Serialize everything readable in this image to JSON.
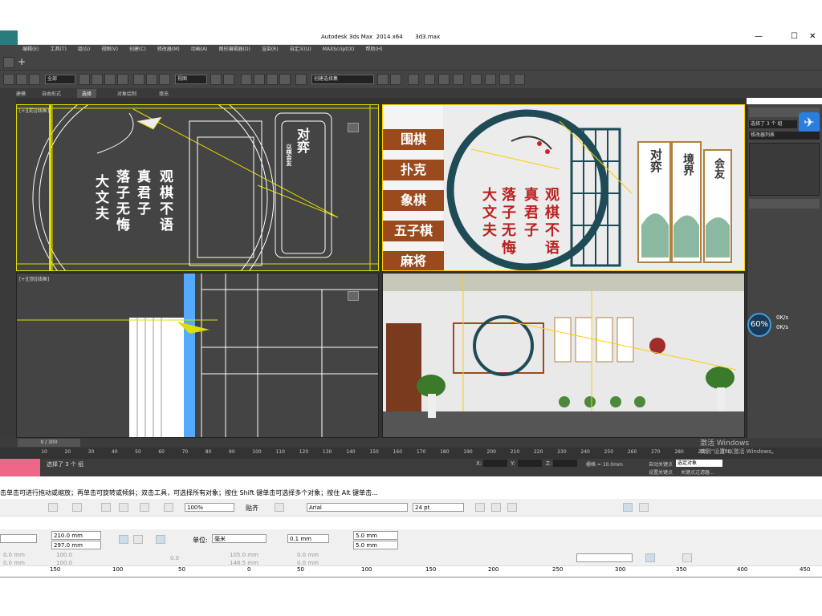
{
  "titlebar": {
    "title": "Autodesk 3ds Max  2014 x64       3d3.max",
    "minimize": "—",
    "maximize": "☐",
    "close": "✕"
  },
  "menu": [
    "编辑(E)",
    "工具(T)",
    "组(G)",
    "视图(V)",
    "创建(C)",
    "修改器(M)",
    "动画(A)",
    "图形编辑器(D)",
    "渲染(R)",
    "自定义(U)",
    "MAXScript(X)",
    "帮助(H)"
  ],
  "toolbar": {
    "filter": "全部",
    "refcoord": "视图",
    "selset": "创建选择集"
  },
  "ribbon_tabs": [
    "建模",
    "自由形式",
    "选择",
    "对象绘制",
    "填充"
  ],
  "viewports": {
    "top_left": "[+][前][线框]",
    "bottom_left": "[+][顶][线框]",
    "tr_text": {
      "side_labels": [
        "围棋",
        "扑克",
        "象棋",
        "五子棋",
        "麻将"
      ],
      "col1": [
        "大",
        "文",
        "夫"
      ],
      "col2": [
        "落",
        "子",
        "无",
        "悔"
      ],
      "col3": [
        "真",
        "君",
        "子"
      ],
      "col4": [
        "观",
        "棋",
        "不",
        "语"
      ],
      "panels": [
        "对弈",
        "境界",
        "会友"
      ]
    },
    "tl_text": {
      "col1": [
        "大",
        "文",
        "夫"
      ],
      "col2": [
        "落",
        "子",
        "无",
        "悔"
      ],
      "col3": [
        "真",
        "君",
        "子"
      ],
      "col4": [
        "观",
        "棋",
        "不",
        "语"
      ],
      "right_panel": "对弈",
      "right_sub": "以棋会友"
    }
  },
  "cmdpanel": {
    "selected": "选择了 3 个 组",
    "modifier_list": "修改器列表",
    "net_percent": "60%",
    "net_up": "0K/s",
    "net_down": "0K/s"
  },
  "timeline": {
    "frame": "0 / 300",
    "ticks": [
      "10",
      "20",
      "30",
      "40",
      "50",
      "60",
      "70",
      "80",
      "90",
      "100",
      "110",
      "120",
      "130",
      "140",
      "150",
      "160",
      "170",
      "180",
      "190",
      "200",
      "210",
      "220",
      "230",
      "240",
      "250",
      "260",
      "270",
      "280",
      "290",
      "300"
    ]
  },
  "status": {
    "selected": "选择了 3 个 组",
    "x_label": "X:",
    "y_label": "Y:",
    "z_label": "Z:",
    "grid": "栅格 = 10.0mm",
    "autokey": "自动关键点",
    "setkey": "设置关键点",
    "keyfilter": "关键点过滤器...",
    "selobj": "选定对象",
    "activate1": "激活 Windows",
    "activate2": "转到\"设置\"以激活 Windows。"
  },
  "hint": "击单击可进行拖动或缩放；再单击可旋转或倾斜；双击工具，可选择所有对象；按住 Shift 键单击可选择多个对象；按住 Alt 键单击...",
  "cdr": {
    "zoom": "100%",
    "snap": "贴齐",
    "font": "Arial",
    "size": "24 pt",
    "width": "210.0 mm",
    "height": "297.0 mm",
    "unit_label": "单位:",
    "unit": "毫米",
    "nudge": "0.1 mm",
    "dup_x": "5.0 mm",
    "dup_y": "5.0 mm",
    "x0": "0.0 mm",
    "y0": "0.0 mm",
    "sx": "100.0",
    "sy": "100.0",
    "angle": "0.0",
    "px": "105.0 mm",
    "py": "148.5 mm",
    "r0": "0.0 mm",
    "r1": "0.0 mm"
  },
  "ruler": [
    "150",
    "100",
    "50",
    "0",
    "50",
    "100",
    "150",
    "200",
    "250",
    "300",
    "350",
    "400",
    "450"
  ]
}
